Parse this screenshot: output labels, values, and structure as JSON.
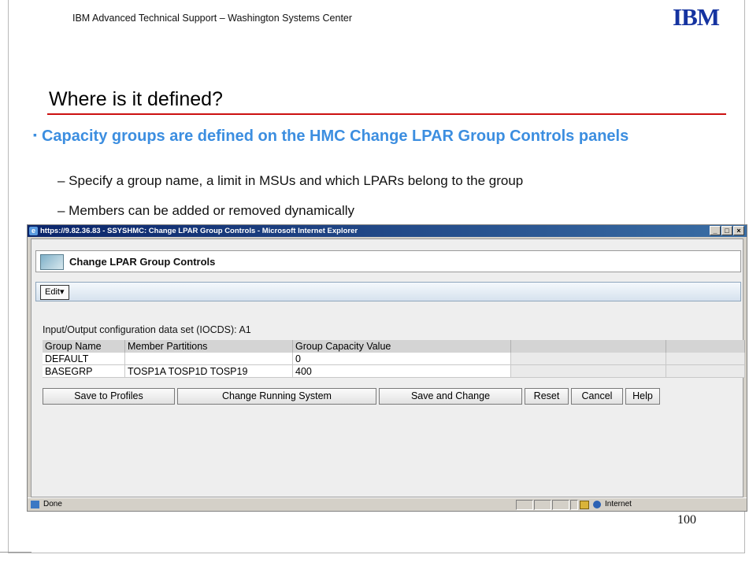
{
  "slide": {
    "header": "IBM Advanced Technical Support – Washington  Systems Center",
    "logo": "IBM",
    "title": "Where is it defined?",
    "bullet": "Capacity groups are defined on the HMC Change LPAR Group Controls panels",
    "sub_items": [
      "– Specify a group name, a limit in MSUs and which LPARs belong to the group",
      "– Members can be added or removed dynamically"
    ],
    "page_number": "100"
  },
  "browser": {
    "title": "https://9.82.36.83 - SSYSHMC: Change LPAR Group Controls - Microsoft Internet Explorer",
    "panel_title": "Change LPAR Group Controls",
    "edit_menu": "Edit",
    "iocds_label": "Input/Output configuration data set (IOCDS): A1",
    "table": {
      "columns": [
        "Group Name",
        "Member Partitions",
        "Group Capacity Value"
      ],
      "rows": [
        {
          "name": "DEFAULT",
          "members": "",
          "capacity": "0"
        },
        {
          "name": "BASEGRP",
          "members": "TOSP1A TOSP1D TOSP19",
          "capacity": "400"
        }
      ]
    },
    "buttons": {
      "save_profiles": "Save to Profiles",
      "change_running": "Change Running System",
      "save_change": "Save and Change",
      "reset": "Reset",
      "cancel": "Cancel",
      "help": "Help"
    },
    "status": {
      "text": "Done",
      "zone": "Internet"
    }
  },
  "colors": {
    "ibm_blue": "#1533a0",
    "bullet_blue": "#3c8ee0",
    "title_rule": "#cc1010",
    "titlebar": "#0a246a"
  }
}
